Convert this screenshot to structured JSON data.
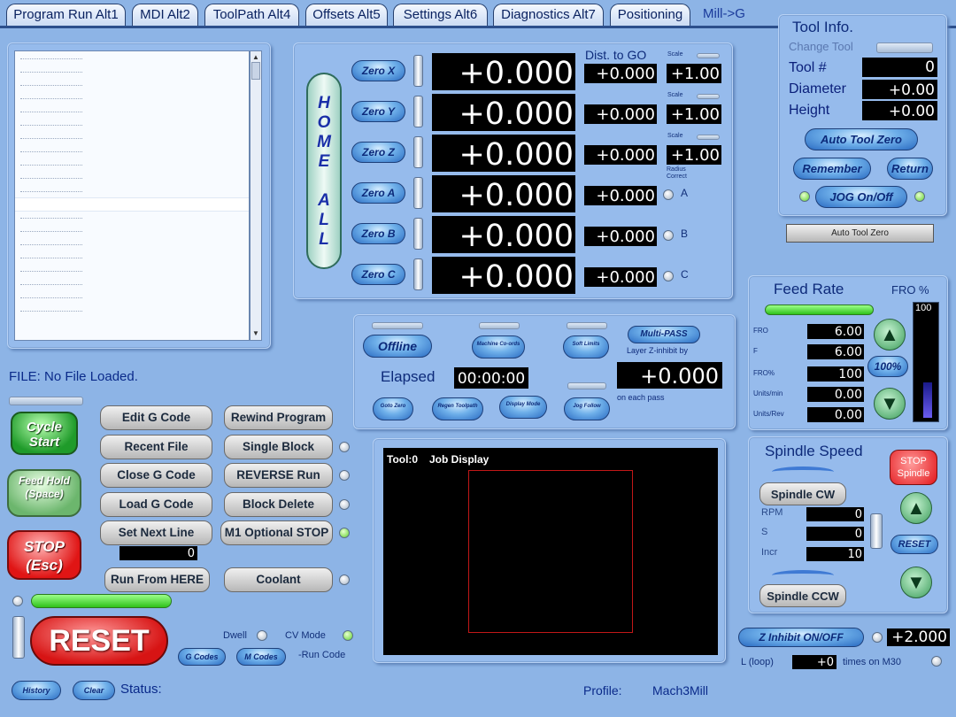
{
  "tabs": [
    "Program Run Alt1",
    "MDI Alt2",
    "ToolPath Alt4",
    "Offsets Alt5",
    "Settings Alt6",
    "Diagnostics Alt7",
    "Positioning"
  ],
  "mode_label": "Mill->G",
  "axes": [
    {
      "zero_label": "Zero X",
      "value": "+0.000",
      "dist": "+0.000",
      "scale_label": "Scale",
      "scale": "+1.00"
    },
    {
      "zero_label": "Zero Y",
      "value": "+0.000",
      "dist": "+0.000",
      "scale_label": "Scale",
      "scale": "+1.00"
    },
    {
      "zero_label": "Zero Z",
      "value": "+0.000",
      "dist": "+0.000",
      "scale_label": "Scale",
      "scale": "+1.00"
    },
    {
      "zero_label": "Zero A",
      "value": "+0.000",
      "dist": "+0.000",
      "letter": "A"
    },
    {
      "zero_label": "Zero B",
      "value": "+0.000",
      "dist": "+0.000",
      "letter": "B"
    },
    {
      "zero_label": "Zero C",
      "value": "+0.000",
      "dist": "+0.000",
      "letter": "C"
    }
  ],
  "dist_to_go_label": "Dist. to GO",
  "radius_correct_label": "Radius Correct",
  "home_all_label": "HOME ALL",
  "tool_info": {
    "title": "Tool Info.",
    "change_tool": "Change Tool",
    "tool_label": "Tool #",
    "tool_value": "0",
    "diameter_label": "Diameter",
    "diameter_value": "+0.00",
    "height_label": "Height",
    "height_value": "+0.00",
    "auto_tool_zero": "Auto Tool Zero",
    "remember": "Remember",
    "return": "Return",
    "jog": "JOG On/Off"
  },
  "auto_tool_zero_bar": "Auto Tool Zero",
  "feed": {
    "title": "Feed Rate",
    "fro_pct_label": "FRO %",
    "fro_max": "100",
    "rows": [
      {
        "label": "FRO",
        "value": "6.00"
      },
      {
        "label": "F",
        "value": "6.00"
      },
      {
        "label": "FRO%",
        "value": "100"
      },
      {
        "label": "Units/min",
        "value": "0.00"
      },
      {
        "label": "Units/Rev",
        "value": "0.00"
      }
    ],
    "pct_button": "100%"
  },
  "spindle": {
    "title": "Spindle Speed",
    "cw": "Spindle CW",
    "ccw": "Spindle CCW",
    "stop": "STOP Spindle",
    "reset": "RESET",
    "rows": [
      {
        "label": "RPM",
        "value": "0"
      },
      {
        "label": "S",
        "value": "0"
      },
      {
        "label": "Incr",
        "value": "10"
      }
    ]
  },
  "mid": {
    "offline": "Offline",
    "machine_coords": "Machine Co-ords",
    "soft_limits": "Soft Limits",
    "multipass": "Multi-PASS",
    "layer_z": "Layer Z-inhibit by",
    "elapsed_label": "Elapsed",
    "elapsed": "00:00:00",
    "multipass_value": "+0.000",
    "each_pass": "on each pass",
    "goto_zero": "Goto Zero",
    "regen": "Regen Toolpath",
    "display_mode": "Display Mode",
    "jog_follow": "Jog Follow"
  },
  "file_label": "FILE:  No File Loaded.",
  "cycle_start": "Cycle Start",
  "feed_hold": "Feed Hold (Space)",
  "stop": "STOP (Esc)",
  "reset": "RESET",
  "buttons_left": [
    "Edit G Code",
    "Recent File",
    "Close G Code",
    "Load G Code",
    "Set Next Line",
    "Run From HERE"
  ],
  "buttons_right": [
    "Rewind Program",
    "Single Block",
    "REVERSE Run",
    "Block Delete",
    "M1 Optional STOP",
    "Coolant"
  ],
  "line_value": "0",
  "dwell": "Dwell",
  "cv_mode": "CV Mode",
  "gcodes": "G Codes",
  "mcodes": "M Codes",
  "run_code": "-Run Code",
  "history": "History",
  "clear": "Clear",
  "status": "Status:",
  "profile_label": "Profile:",
  "profile": "Mach3Mill",
  "job_display": {
    "tool": "Tool:0",
    "title": "Job Display"
  },
  "z_inhibit": "Z Inhibit ON/OFF",
  "z_inhibit_value": "+2.000",
  "loop_label": "L (loop)",
  "loop_value": "+0",
  "times_m30": "times on M30"
}
